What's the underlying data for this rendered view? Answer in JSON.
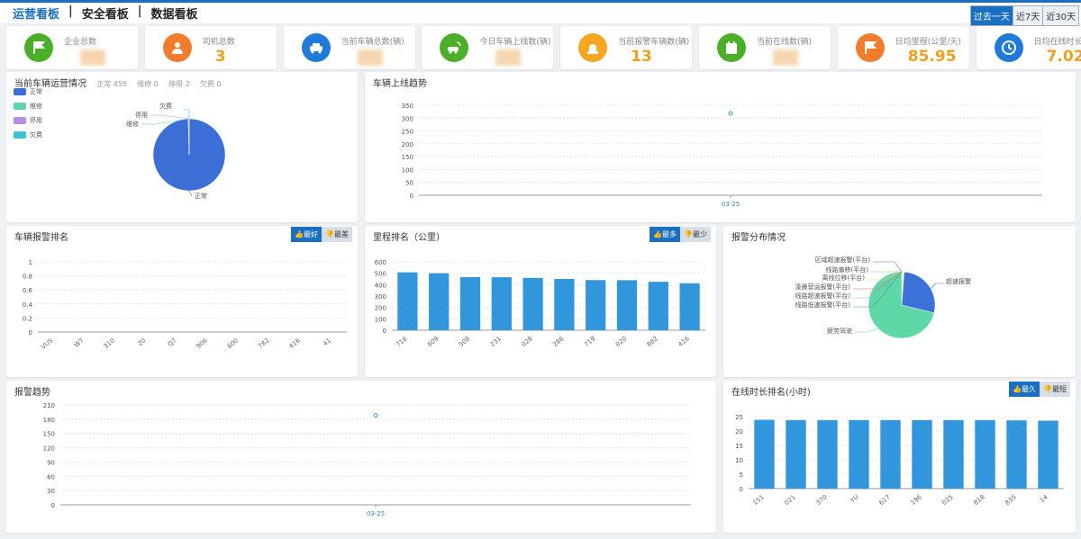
{
  "nav": {
    "tabs": [
      {
        "label": "运营看板"
      },
      {
        "label": "安全看板"
      },
      {
        "label": "数据看板"
      }
    ],
    "active": 0,
    "separator": "|"
  },
  "range": {
    "options": [
      {
        "label": "过去一天"
      },
      {
        "label": "近7天"
      },
      {
        "label": "近30天"
      }
    ],
    "selected": 0
  },
  "cards": [
    {
      "label": "企业总数",
      "value": "",
      "icon": "flag-icon",
      "color": "#4caf2a"
    },
    {
      "label": "司机总数",
      "value": "3",
      "icon": "driver-icon",
      "color": "#ef7d2c"
    },
    {
      "label": "当前车辆总数(辆)",
      "value": "",
      "icon": "car-icon",
      "color": "#1f7ad8"
    },
    {
      "label": "今日车辆上线数(辆)",
      "value": "",
      "icon": "online-car-icon",
      "color": "#4caf2a"
    },
    {
      "label": "当前报警车辆数(辆)",
      "value": "13",
      "icon": "alarm-light-icon",
      "color": "#f5a623"
    },
    {
      "label": "当前在线数(辆)",
      "value": "",
      "icon": "calendar-icon",
      "color": "#4caf2a"
    },
    {
      "label": "日均里程(公里/天)",
      "value": "85.95",
      "icon": "flag-icon",
      "color": "#ef7d2c"
    },
    {
      "label": "日均在线时长(时/天)",
      "value": "7.02",
      "icon": "clock-icon",
      "color": "#1f7ad8"
    }
  ],
  "vehicle_status": {
    "title": "当前车辆运营情况",
    "stats": [
      {
        "label": "正常",
        "value": "455"
      },
      {
        "label": "维修",
        "value": "0"
      },
      {
        "label": "停用",
        "value": "2"
      },
      {
        "label": "欠费",
        "value": "0"
      }
    ],
    "legend": [
      {
        "label": "正常",
        "color": "#3c6fd6"
      },
      {
        "label": "维修",
        "color": "#5cd6a8"
      },
      {
        "label": "停用",
        "color": "#b98de6"
      },
      {
        "label": "欠费",
        "color": "#3fc1d4"
      }
    ]
  },
  "online_trend": {
    "title": "车辆上线趋势"
  },
  "alarm_rank": {
    "title": "车辆报警排名",
    "toggle": [
      {
        "label": "最好"
      },
      {
        "label": "最差"
      }
    ],
    "selected": 0
  },
  "mileage_rank": {
    "title": "里程排名（公里）",
    "toggle": [
      {
        "label": "最多"
      },
      {
        "label": "最少"
      }
    ],
    "selected": 0
  },
  "alarm_dist": {
    "title": "报警分布情况"
  },
  "alarm_trend": {
    "title": "报警趋势"
  },
  "online_rank": {
    "title": "在线时长排名(小时)",
    "toggle": [
      {
        "label": "最久"
      },
      {
        "label": "最短"
      }
    ],
    "selected": 0
  },
  "chart_data": [
    {
      "id": "vehicle_status",
      "type": "pie",
      "labels": [
        "正常",
        "维修",
        "停用",
        "欠费"
      ],
      "values": [
        455,
        0,
        2,
        0
      ],
      "colors": [
        "#3c6fd6",
        "#5cd6a8",
        "#b98de6",
        "#3fc1d4"
      ]
    },
    {
      "id": "online_trend",
      "type": "scatter",
      "x": [
        "03-25"
      ],
      "y": [
        318
      ],
      "ylim": [
        0,
        350
      ],
      "yticks": [
        0,
        50,
        100,
        150,
        200,
        250,
        300,
        350
      ]
    },
    {
      "id": "alarm_rank",
      "type": "bar",
      "categories": [
        "VUS",
        "W7",
        "310",
        "20",
        "Q7",
        "906",
        "600",
        "782",
        "416",
        "41"
      ],
      "values": [
        0,
        0,
        0,
        0,
        0,
        0,
        0,
        0,
        0,
        0
      ],
      "ylim": [
        0,
        1
      ],
      "yticks": [
        0,
        0.2,
        0.4,
        0.6,
        0.8,
        1
      ]
    },
    {
      "id": "mileage_rank",
      "type": "bar",
      "categories": [
        "716",
        "609",
        "508",
        "231",
        "028",
        "286",
        "719",
        "020",
        "882",
        "416"
      ],
      "values": [
        508,
        500,
        466,
        465,
        459,
        450,
        440,
        439,
        425,
        412
      ],
      "ylim": [
        0,
        600
      ],
      "yticks": [
        0,
        100,
        200,
        300,
        400,
        500,
        600
      ],
      "color": "#3296dc"
    },
    {
      "id": "alarm_dist",
      "type": "pie",
      "labels": [
        "区域超速报警(平台)",
        "线路偏移(平台)",
        "离线位移(平台)",
        "凌晨营运报警(平台)",
        "线路超速报警(平台)",
        "线路低速报警(平台)",
        "超速报警",
        "疲劳驾驶"
      ],
      "values": [
        0.2,
        0.2,
        0.2,
        0.2,
        0.2,
        0.2,
        28,
        72
      ],
      "colors": [
        "#5470c6",
        "#91cc75",
        "#fac858",
        "#ee6666",
        "#73c0de",
        "#3ba272",
        "#3c72d8",
        "#5fd8a8"
      ]
    },
    {
      "id": "alarm_trend",
      "type": "scatter",
      "x": [
        "03-25"
      ],
      "y": [
        188
      ],
      "ylim": [
        0,
        210
      ],
      "yticks": [
        0,
        30,
        60,
        90,
        120,
        150,
        180,
        210
      ]
    },
    {
      "id": "online_rank",
      "type": "bar",
      "categories": [
        "151",
        "021",
        "370",
        "YU",
        "617",
        "196",
        "025",
        "818",
        "835",
        "14"
      ],
      "values": [
        23.9,
        23.8,
        23.8,
        23.8,
        23.8,
        23.8,
        23.8,
        23.8,
        23.7,
        23.6
      ],
      "ylim": [
        0,
        25
      ],
      "yticks": [
        0,
        5,
        10,
        15,
        20,
        25
      ],
      "color": "#3296dc"
    }
  ]
}
